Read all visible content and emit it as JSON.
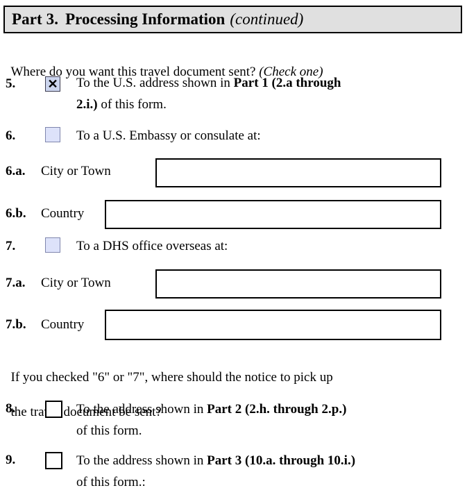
{
  "header": {
    "part_label": "Part 3.",
    "title": "Processing Information",
    "continued": "(continued)"
  },
  "prompts": {
    "where_sent_main": "Where do you want this travel document sent? ",
    "where_sent_italic": "(Check one)",
    "notice_pickup_line1": "If you checked \"6\" or \"7\", where should the notice to pick up",
    "notice_pickup_line2": "the travel document be sent?"
  },
  "items": [
    {
      "number": "5.",
      "checkbox": {
        "name": "checkbox-item-5",
        "style": "filled",
        "checked": true,
        "mark": "✕"
      },
      "text_line1_pre": "To the U.S. address shown in ",
      "text_line1_bold": "Part 1 (2.a through",
      "text_line2_bold": "2.i.)",
      "text_line2_post": " of this form."
    },
    {
      "number": "6.",
      "checkbox": {
        "name": "checkbox-item-6",
        "style": "filled",
        "checked": false,
        "mark": ""
      },
      "text": "To a U.S. Embassy or consulate at:"
    },
    {
      "number": "7.",
      "checkbox": {
        "name": "checkbox-item-7",
        "style": "filled",
        "checked": false,
        "mark": ""
      },
      "text": "To a DHS office overseas at:"
    },
    {
      "number": "8.",
      "checkbox": {
        "name": "checkbox-item-8",
        "style": "plain",
        "checked": false,
        "mark": ""
      },
      "text_line1_pre": "To the address shown in ",
      "text_line1_bold": "Part 2 (2.h. through 2.p.)",
      "text_line2": "of this form."
    },
    {
      "number": "9.",
      "checkbox": {
        "name": "checkbox-item-9",
        "style": "plain",
        "checked": false,
        "mark": ""
      },
      "text_line1_pre": "To the address shown in ",
      "text_line1_bold": "Part 3 (10.a. through 10.i.)",
      "text_line2": "of this form.:"
    }
  ],
  "fields": [
    {
      "number": "6.a.",
      "label": "City or Town",
      "value": "",
      "placeholder": ""
    },
    {
      "number": "6.b.",
      "label": "Country",
      "value": "",
      "placeholder": ""
    },
    {
      "number": "7.a.",
      "label": "City or Town",
      "value": "",
      "placeholder": ""
    },
    {
      "number": "7.b.",
      "label": "Country",
      "value": "",
      "placeholder": ""
    }
  ],
  "colors": {
    "header_bg": "#e0e0e0",
    "checkbox_fill": "#dde2fa",
    "checkbox_fill_checked": "#ccd5ee",
    "border": "#000000"
  }
}
